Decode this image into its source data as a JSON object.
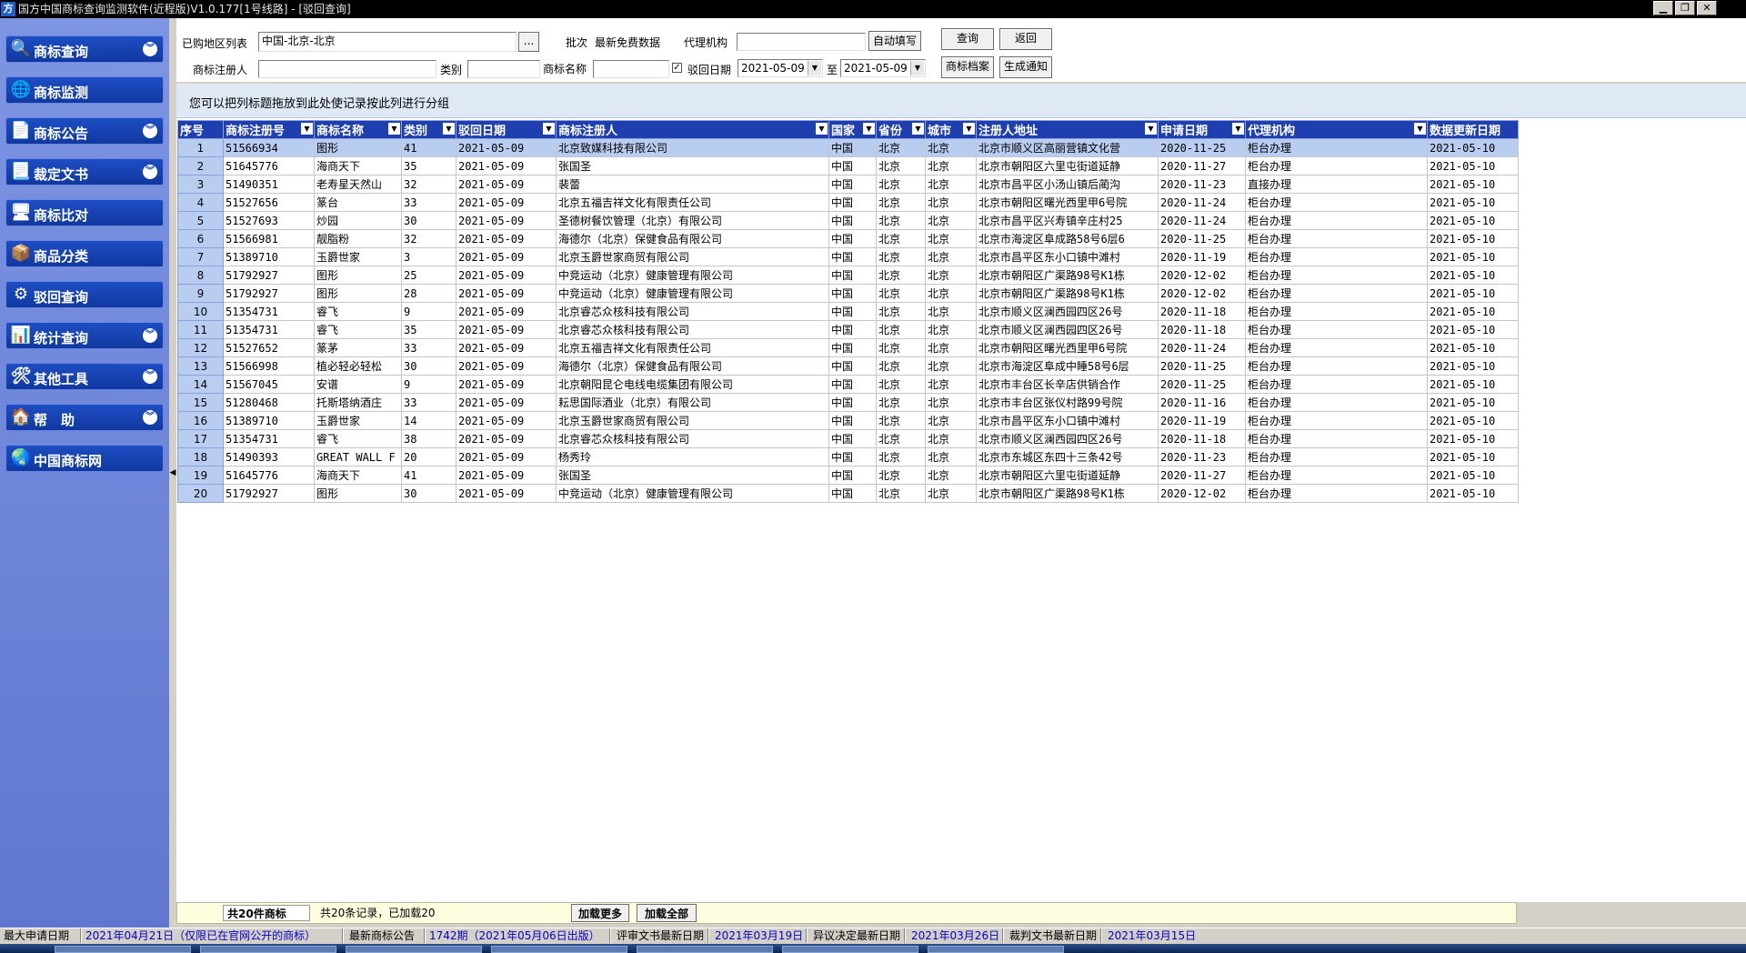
{
  "window": {
    "title": "国方中国商标查询监测软件(近程版)V1.0.177[1号线路] - [驳回查询]",
    "app_icon": "方",
    "controls": [
      "minimize-icon",
      "restore-icon",
      "close-icon"
    ]
  },
  "sidebar": {
    "items": [
      {
        "label": "商标查询",
        "icon": "magnifier-icon",
        "glyph": "🔍",
        "chevron": true
      },
      {
        "label": "商标监测",
        "icon": "monitor-globe-icon",
        "glyph": "🌐",
        "chevron": false
      },
      {
        "label": "商标公告",
        "icon": "notice-document-icon",
        "glyph": "📄",
        "chevron": true
      },
      {
        "label": "裁定文书",
        "icon": "ruling-document-icon",
        "glyph": "📃",
        "chevron": true
      },
      {
        "label": "商标比对",
        "icon": "compare-icon",
        "glyph": "🖥",
        "chevron": false
      },
      {
        "label": "商品分类",
        "icon": "goods-category-icon",
        "glyph": "📦",
        "chevron": false
      },
      {
        "label": "驳回查询",
        "icon": "reject-query-icon",
        "glyph": "⚙",
        "chevron": false
      },
      {
        "label": "统计查询",
        "icon": "statistics-icon",
        "glyph": "📊",
        "chevron": true
      },
      {
        "label": "其他工具",
        "icon": "tools-icon",
        "glyph": "🛠",
        "chevron": true
      },
      {
        "label": "帮　助",
        "icon": "help-icon",
        "glyph": "🏠",
        "chevron": true
      },
      {
        "label": "中国商标网",
        "icon": "globe-icon",
        "glyph": "🌏",
        "chevron": false
      }
    ],
    "chevron_glyph": "︾"
  },
  "form": {
    "region_label": "已购地区列表",
    "region_value": "中国-北京-北京",
    "region_browse_label": "...",
    "batch_label": "批次",
    "batch_value": "最新免费数据",
    "agency_label": "代理机构",
    "agency_value": "",
    "autofill_label": "自动填写",
    "query_label": "查询",
    "back_label": "返回",
    "registrant_label": "商标注册人",
    "registrant_value": "",
    "class_label": "类别",
    "class_value": "",
    "name_label": "商标名称",
    "name_value": "",
    "reject_date_checked": true,
    "checkmark": "✓",
    "reject_date_label": "驳回日期",
    "date_from": "2021-05-09",
    "to_label": "至",
    "date_to": "2021-05-09",
    "archive_label": "商标档案",
    "notice_label": "生成通知"
  },
  "group_hint": "您可以把列标题拖放到此处使记录按此列进行分组",
  "grid": {
    "columns": [
      "序号",
      "商标注册号",
      "商标名称",
      "类别",
      "驳回日期",
      "商标注册人",
      "国家",
      "省份",
      "城市",
      "注册人地址",
      "申请日期",
      "代理机构",
      "数据更新日期"
    ],
    "filter_glyph": "▼",
    "rows": [
      [
        "1",
        "51566934",
        "图形",
        "41",
        "2021-05-09",
        "北京致媒科技有限公司",
        "中国",
        "北京",
        "北京",
        "北京市顺义区高丽营镇文化营",
        "2020-11-25",
        "柜台办理",
        "2021-05-10"
      ],
      [
        "2",
        "51645776",
        "海商天下",
        "35",
        "2021-05-09",
        "张国圣",
        "中国",
        "北京",
        "北京",
        "北京市朝阳区六里屯街道延静",
        "2020-11-27",
        "柜台办理",
        "2021-05-10"
      ],
      [
        "3",
        "51490351",
        "老寿星天然山",
        "32",
        "2021-05-09",
        "裴蕾",
        "中国",
        "北京",
        "北京",
        "北京市昌平区小汤山镇后蔺沟",
        "2020-11-23",
        "直接办理",
        "2021-05-10"
      ],
      [
        "4",
        "51527656",
        "篆台",
        "33",
        "2021-05-09",
        "北京五福吉祥文化有限责任公司",
        "中国",
        "北京",
        "北京",
        "北京市朝阳区曙光西里甲6号院",
        "2020-11-24",
        "柜台办理",
        "2021-05-10"
      ],
      [
        "5",
        "51527693",
        "炒园",
        "30",
        "2021-05-09",
        "圣德树餐饮管理（北京）有限公司",
        "中国",
        "北京",
        "北京",
        "北京市昌平区兴寿镇辛庄村25",
        "2020-11-24",
        "柜台办理",
        "2021-05-10"
      ],
      [
        "6",
        "51566981",
        "靓脂粉",
        "32",
        "2021-05-09",
        "海德尔（北京）保健食品有限公司",
        "中国",
        "北京",
        "北京",
        "北京市海淀区阜成路58号6层6",
        "2020-11-25",
        "柜台办理",
        "2021-05-10"
      ],
      [
        "7",
        "51389710",
        "玉爵世家",
        "3",
        "2021-05-09",
        "北京玉爵世家商贸有限公司",
        "中国",
        "北京",
        "北京",
        "北京市昌平区东小口镇中滩村",
        "2020-11-19",
        "柜台办理",
        "2021-05-10"
      ],
      [
        "8",
        "51792927",
        "图形",
        "25",
        "2021-05-09",
        "中竞运动（北京）健康管理有限公司",
        "中国",
        "北京",
        "北京",
        "北京市朝阳区广渠路98号K1栋",
        "2020-12-02",
        "柜台办理",
        "2021-05-10"
      ],
      [
        "9",
        "51792927",
        "图形",
        "28",
        "2021-05-09",
        "中竞运动（北京）健康管理有限公司",
        "中国",
        "北京",
        "北京",
        "北京市朝阳区广渠路98号K1栋",
        "2020-12-02",
        "柜台办理",
        "2021-05-10"
      ],
      [
        "10",
        "51354731",
        "睿飞",
        "9",
        "2021-05-09",
        "北京睿芯众核科技有限公司",
        "中国",
        "北京",
        "北京",
        "北京市顺义区澜西园四区26号",
        "2020-11-18",
        "柜台办理",
        "2021-05-10"
      ],
      [
        "11",
        "51354731",
        "睿飞",
        "35",
        "2021-05-09",
        "北京睿芯众核科技有限公司",
        "中国",
        "北京",
        "北京",
        "北京市顺义区澜西园四区26号",
        "2020-11-18",
        "柜台办理",
        "2021-05-10"
      ],
      [
        "12",
        "51527652",
        "篆茅",
        "33",
        "2021-05-09",
        "北京五福吉祥文化有限责任公司",
        "中国",
        "北京",
        "北京",
        "北京市朝阳区曙光西里甲6号院",
        "2020-11-24",
        "柜台办理",
        "2021-05-10"
      ],
      [
        "13",
        "51566998",
        "植必轻必轻松",
        "30",
        "2021-05-09",
        "海德尔（北京）保健食品有限公司",
        "中国",
        "北京",
        "北京",
        "北京市海淀区阜成中睡58号6层",
        "2020-11-25",
        "柜台办理",
        "2021-05-10"
      ],
      [
        "14",
        "51567045",
        "安谱",
        "9",
        "2021-05-09",
        "北京朝阳昆仑电线电缆集团有限公司",
        "中国",
        "北京",
        "北京",
        "北京市丰台区长辛店供销合作",
        "2020-11-25",
        "柜台办理",
        "2021-05-10"
      ],
      [
        "15",
        "51280468",
        "托斯塔纳酒庄",
        "33",
        "2021-05-09",
        "耘思国际酒业（北京）有限公司",
        "中国",
        "北京",
        "北京",
        "北京市丰台区张仪村路99号院",
        "2020-11-16",
        "柜台办理",
        "2021-05-10"
      ],
      [
        "16",
        "51389710",
        "玉爵世家",
        "14",
        "2021-05-09",
        "北京玉爵世家商贸有限公司",
        "中国",
        "北京",
        "北京",
        "北京市昌平区东小口镇中滩村",
        "2020-11-19",
        "柜台办理",
        "2021-05-10"
      ],
      [
        "17",
        "51354731",
        "睿飞",
        "38",
        "2021-05-09",
        "北京睿芯众核科技有限公司",
        "中国",
        "北京",
        "北京",
        "北京市顺义区澜西园四区26号",
        "2020-11-18",
        "柜台办理",
        "2021-05-10"
      ],
      [
        "18",
        "51490393",
        "GREAT WALL F",
        "20",
        "2021-05-09",
        "杨秀玲",
        "中国",
        "北京",
        "北京",
        "北京市东城区东四十三条42号",
        "2020-11-23",
        "柜台办理",
        "2021-05-10"
      ],
      [
        "19",
        "51645776",
        "海商天下",
        "41",
        "2021-05-09",
        "张国圣",
        "中国",
        "北京",
        "北京",
        "北京市朝阳区六里屯街道延静",
        "2020-11-27",
        "柜台办理",
        "2021-05-10"
      ],
      [
        "20",
        "51792927",
        "图形",
        "30",
        "2021-05-09",
        "中竞运动（北京）健康管理有限公司",
        "中国",
        "北京",
        "北京",
        "北京市朝阳区广渠路98号K1栋",
        "2020-12-02",
        "柜台办理",
        "2021-05-10"
      ]
    ]
  },
  "footer": {
    "total_label": "共20件商标",
    "loaded_status": "共20条记录，已加载20",
    "load_more_label": "加载更多",
    "load_all_label": "加载全部"
  },
  "statusbar": {
    "max_apply_label": "最大申请日期",
    "max_apply_value": "2021年04月21日（仅限已在官网公开的商标）",
    "latest_notice_label": "最新商标公告",
    "latest_notice_value": "1742期（2021年05月06日出版）",
    "review_doc_label": "评审文书最新日期",
    "review_doc_value": "2021年03月19日",
    "objection_label": "异议决定最新日期",
    "objection_value": "2021年03月26日",
    "ruling_label": "裁判文书最新日期",
    "ruling_value": "2021年03月15日"
  },
  "colors": {
    "grid_header": "#1f3fb0",
    "selected_row": "#b9cdf0",
    "sidebar_item": "#1e4ec4",
    "status_value": "#0000c8"
  }
}
